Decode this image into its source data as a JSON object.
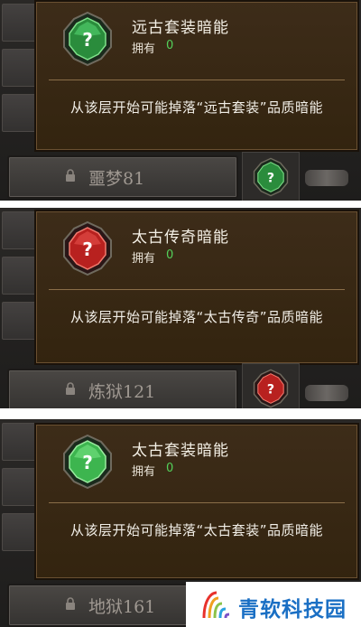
{
  "panels": [
    {
      "tooltip": {
        "gem_color": "green",
        "gem_icon": "question-mark-gem-icon",
        "title": "远古套装暗能",
        "own_label": "拥有",
        "own_value": "0",
        "description": "从该层开始可能掉落“远古套装”品质暗能"
      },
      "floor_button": {
        "icon": "lock-icon",
        "label": "噩梦81"
      }
    },
    {
      "tooltip": {
        "gem_color": "red",
        "gem_icon": "question-mark-gem-icon",
        "title": "太古传奇暗能",
        "own_label": "拥有",
        "own_value": "0",
        "description": "从该层开始可能掉落“太古传奇”品质暗能"
      },
      "floor_button": {
        "icon": "lock-icon",
        "label": "炼狱121"
      }
    },
    {
      "tooltip": {
        "gem_color": "green",
        "gem_icon": "question-mark-gem-icon",
        "title": "太古套装暗能",
        "own_label": "拥有",
        "own_value": "0",
        "description": "从该层开始可能掉落“太古套装”品质暗能"
      },
      "floor_button": {
        "icon": "lock-icon",
        "label": "地狱161"
      }
    }
  ],
  "watermark": {
    "text": "青软科技园"
  },
  "colors": {
    "own_value": "#53d05a",
    "gem_green": "#2fa84a",
    "gem_red": "#d12a2a",
    "tooltip_bg": "#3d2c19",
    "tooltip_border": "#6a5031",
    "watermark_text": "#1a6fc4"
  }
}
